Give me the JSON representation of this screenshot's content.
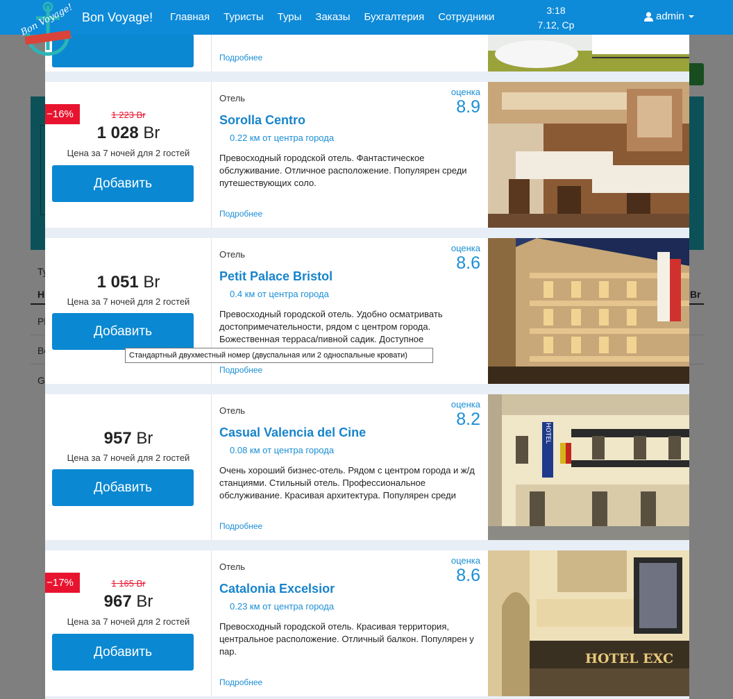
{
  "navbar": {
    "brand": "Bon Voyage!",
    "logo_text": "Bon Voyage!",
    "menu": [
      "Главная",
      "Туристы",
      "Туры",
      "Заказы",
      "Бухгалтерия",
      "Сотрудники"
    ],
    "time": "3:18",
    "date": "7.12, Ср",
    "user": "admin",
    "user_icon": "user-icon",
    "color": "#0d8ad8"
  },
  "background": {
    "texts": [
      "Ту",
      "Н",
      "Pl",
      "Bo",
      "G",
      "Br"
    ]
  },
  "hotels": {
    "partial": {
      "more_label": "Подробнее"
    },
    "items": [
      {
        "discount": "−16%",
        "old_price": "1 223 Br",
        "price_value": "1 028",
        "currency": "Br",
        "price_note": "Цена за 7 ночей для 2 гостей",
        "add_label": "Добавить",
        "type": "Отель",
        "score_label": "оценка",
        "score": "8.9",
        "name": "Sorolla Centro",
        "distance": "0.22 км от центра города",
        "description": "Превосходный городской отель. Фантастическое обслуживание. Отличное расположение. Популярен среди путешествующих соло.",
        "more_label": "Подробнее"
      },
      {
        "discount": "",
        "old_price": "",
        "price_value": "1 051",
        "currency": "Br",
        "price_note": "Цена за 7 ночей для 2 гостей",
        "add_label": "Добавить",
        "type": "Отель",
        "score_label": "оценка",
        "score": "8.6",
        "name": "Petit Palace Bristol",
        "distance": "0.4 км от центра города",
        "description": "Превосходный городской отель. Удобно осматривать достопримечательности, рядом с центром города. Божественная терраса/пивной садик. Доступное",
        "more_label": "Подробнее"
      },
      {
        "discount": "",
        "old_price": "",
        "price_value": "957",
        "currency": "Br",
        "price_note": "Цена за 7 ночей для 2 гостей",
        "add_label": "Добавить",
        "type": "Отель",
        "score_label": "оценка",
        "score": "8.2",
        "name": "Casual Valencia del Cine",
        "distance": "0.08 км от центра города",
        "description": "Очень хороший бизнес-отель. Рядом с центром города и ж/д станциями. Стильный отель. Профессиональное обслуживание. Красивая архитектура. Популярен среди",
        "more_label": "Подробнее",
        "photo_sign": "HOTEL"
      },
      {
        "discount": "−17%",
        "old_price": "1 165 Br",
        "price_value": "967",
        "currency": "Br",
        "price_note": "Цена за 7 ночей для 2 гостей",
        "add_label": "Добавить",
        "type": "Отель",
        "score_label": "оценка",
        "score": "8.6",
        "name": "Catalonia Excelsior",
        "distance": "0.23 км от центра города",
        "description": "Превосходный городской отель. Красивая территория, центральное расположение. Отличный балкон. Популярен у пар.",
        "more_label": "Подробнее",
        "photo_sign": "HOTEL EXC"
      }
    ]
  },
  "tooltip": "Стандартный двухместный номер (двуспальная или 2 односпальные кровати)"
}
